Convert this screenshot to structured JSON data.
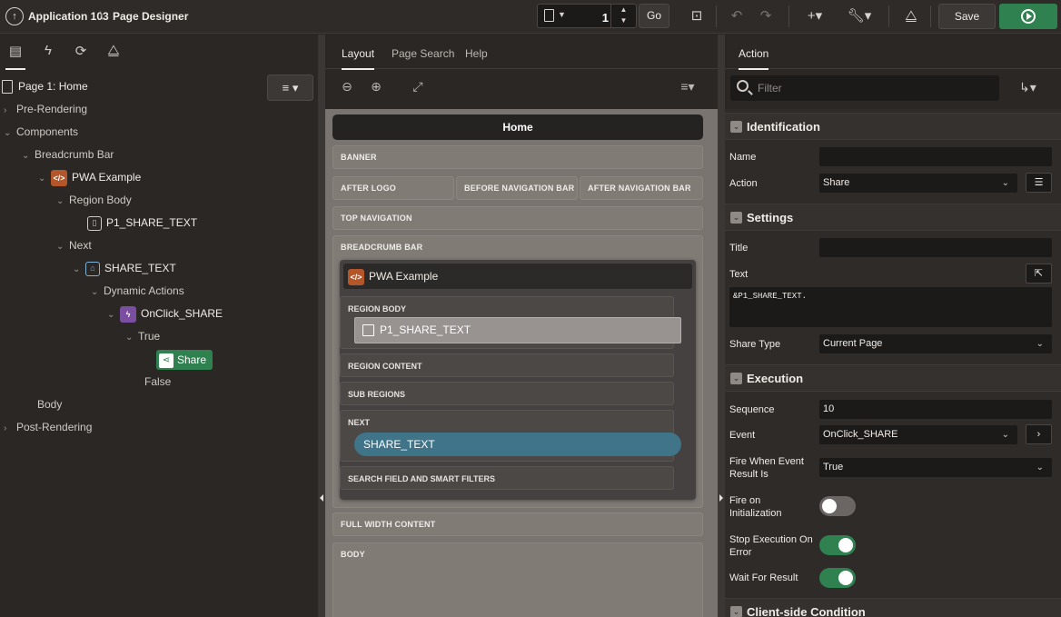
{
  "topbar": {
    "app_name": "Application 103",
    "page_designer": "Page Designer",
    "page_number": "1",
    "go_label": "Go",
    "save_label": "Save"
  },
  "tree": {
    "root": "Page 1: Home",
    "pre_rendering": "Pre-Rendering",
    "components": "Components",
    "breadcrumb_bar": "Breadcrumb Bar",
    "pwa_example": "PWA Example",
    "region_body": "Region Body",
    "p1_share_text": "P1_SHARE_TEXT",
    "next": "Next",
    "share_text": "SHARE_TEXT",
    "dynamic_actions": "Dynamic Actions",
    "onclick_share": "OnClick_SHARE",
    "true_label": "True",
    "share": "Share",
    "false_label": "False",
    "body": "Body",
    "post_rendering": "Post-Rendering"
  },
  "center": {
    "tabs": [
      "Layout",
      "Page Search",
      "Help"
    ],
    "home": "Home",
    "banner": "BANNER",
    "after_logo": "AFTER LOGO",
    "before_nav": "BEFORE NAVIGATION BAR",
    "after_nav": "AFTER NAVIGATION BAR",
    "top_nav": "TOP NAVIGATION",
    "breadcrumb_bar": "BREADCRUMB BAR",
    "region_title": "PWA Example",
    "region_body": "REGION BODY",
    "item": "P1_SHARE_TEXT",
    "region_content": "REGION CONTENT",
    "sub_regions": "SUB REGIONS",
    "next": "NEXT",
    "button": "SHARE_TEXT",
    "search_field": "SEARCH FIELD AND SMART FILTERS",
    "full_width": "FULL WIDTH CONTENT",
    "body": "BODY"
  },
  "right": {
    "tab": "Action",
    "filter_placeholder": "Filter",
    "identification": "Identification",
    "name_label": "Name",
    "name_value": "",
    "action_label": "Action",
    "action_value": "Share",
    "settings": "Settings",
    "title_label": "Title",
    "title_value": "",
    "text_label": "Text",
    "text_value": "&P1_SHARE_TEXT.",
    "share_type_label": "Share Type",
    "share_type_value": "Current Page",
    "execution": "Execution",
    "sequence_label": "Sequence",
    "sequence_value": "10",
    "event_label": "Event",
    "event_value": "OnClick_SHARE",
    "fire_when_label_1": "Fire When Event",
    "fire_when_label_2": "Result Is",
    "fire_when_value": "True",
    "fire_on_init_1": "Fire on",
    "fire_on_init_2": "Initialization",
    "fire_on_init_on": false,
    "stop_exec_1": "Stop Execution On",
    "stop_exec_2": "Error",
    "stop_exec_on": true,
    "wait_label": "Wait For Result",
    "wait_on": true,
    "client_condition": "Client-side Condition"
  },
  "colors": {
    "accent_green": "#2f8150",
    "region_orange": "#b3562a",
    "button_blue": "#3f7489"
  }
}
